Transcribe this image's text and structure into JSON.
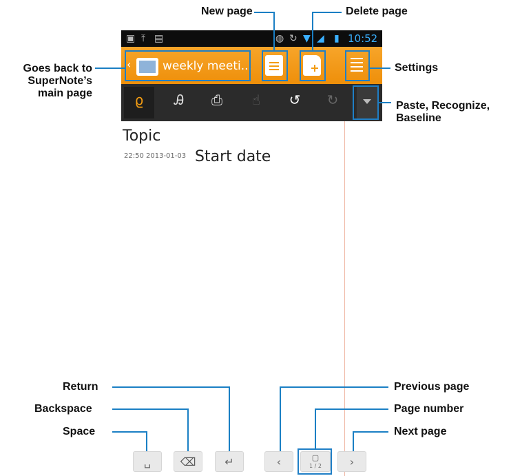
{
  "callouts": {
    "new_page": "New page",
    "delete_page": "Delete page",
    "goes_back": [
      "Goes back to",
      "SuperNote’s",
      "main page"
    ],
    "settings": "Settings",
    "paste": [
      "Paste, Recognize,",
      "Baseline"
    ],
    "return": "Return",
    "backspace": "Backspace",
    "space": "Space",
    "previous_page": "Previous page",
    "page_number": "Page number",
    "next_page": "Next page"
  },
  "screen": {
    "clock": "10:52",
    "notebook_title": "weekly meeti...",
    "topic": "Topic",
    "timestamp": "22:50 2013-01-03",
    "start_date": "Start date",
    "page_indicator": "1 / 2"
  },
  "colors": {
    "callout_line": "#1a7fc4",
    "action_bar": "#f39c12",
    "toolbar": "#2b2b2b",
    "status_bar": "#0d0d0d"
  }
}
